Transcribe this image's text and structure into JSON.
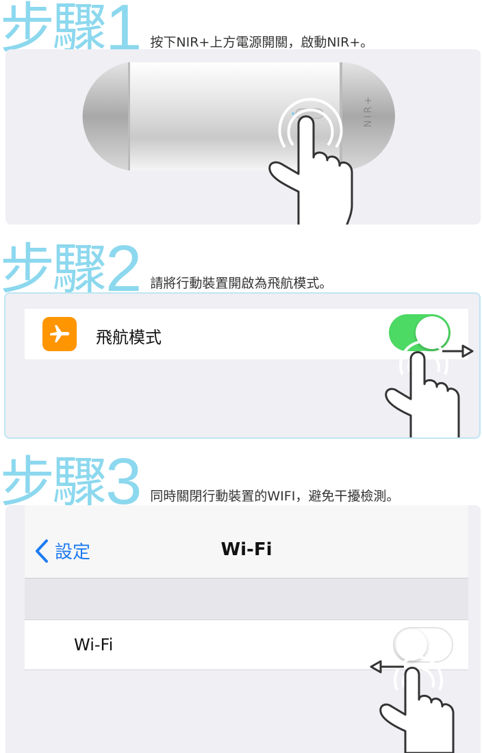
{
  "steps": [
    {
      "big": "步驟",
      "num": "1",
      "desc": "按下NIR+上方電源開關，啟動NIR+。"
    },
    {
      "big": "步驟",
      "num": "2",
      "desc": "請將行動裝置開啟為飛航模式。"
    },
    {
      "big": "步驟",
      "num": "3",
      "desc": "同時關閉行動裝置的WIFI，避免干擾檢測。"
    }
  ],
  "device": {
    "label": "NIR+"
  },
  "airplane": {
    "label": "飛航模式",
    "toggle_on": true,
    "icon": "airplane-icon"
  },
  "wifi_screen": {
    "back_label": "設定",
    "title": "Wi-Fi",
    "row_label": "Wi-Fi",
    "toggle_on": false
  },
  "colors": {
    "step_title": "#8cd8ee",
    "toggle_on": "#4cd964",
    "airplane_bg": "#ff9500",
    "link": "#1e7bf2"
  }
}
